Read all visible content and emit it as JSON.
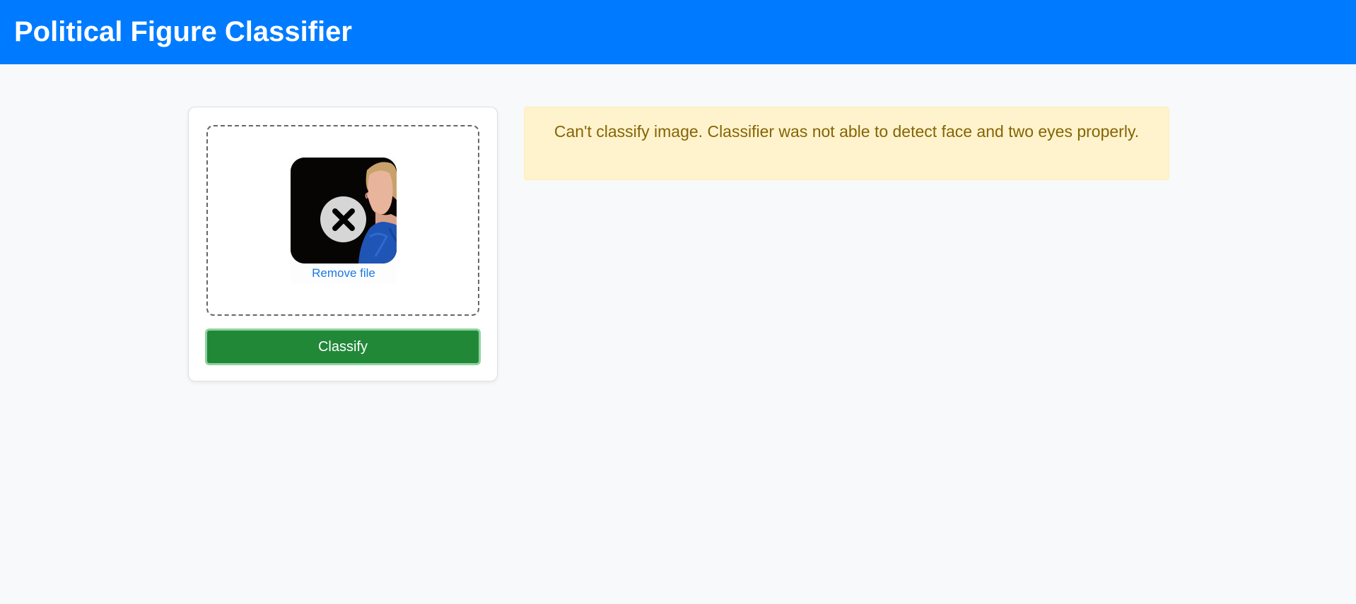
{
  "header": {
    "title": "Political Figure Classifier"
  },
  "upload": {
    "remove_label": "Remove file",
    "status_icon": "error-x-icon"
  },
  "actions": {
    "classify_label": "Classify"
  },
  "alert": {
    "message": "Can't classify image. Classifier was not able to detect face and two eyes properly."
  },
  "colors": {
    "header_bg": "#007bff",
    "button_bg": "#218838",
    "button_ring": "#8fd19e",
    "alert_bg": "#fff3cd",
    "alert_text": "#856404",
    "link": "#1a7ae6"
  }
}
